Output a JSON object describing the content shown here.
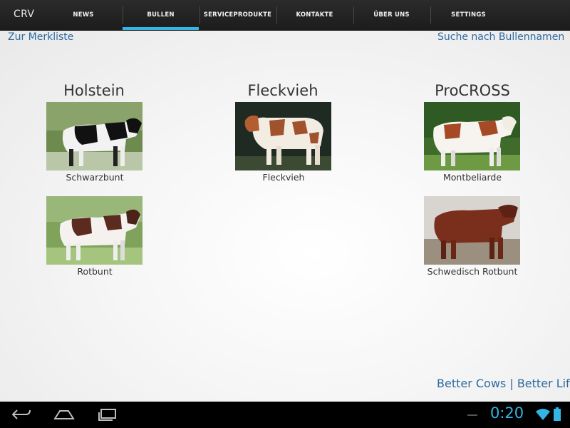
{
  "app": {
    "title": "CRV"
  },
  "tabs": [
    {
      "label": "News"
    },
    {
      "label": "Bullen"
    },
    {
      "label": "Serviceprodukte"
    },
    {
      "label": "Kontakte"
    },
    {
      "label": "Über uns"
    },
    {
      "label": "Settings"
    }
  ],
  "active_tab": "Bullen",
  "links": {
    "merkliste": "Zur Merkliste",
    "suche": "Suche nach Bullennamen"
  },
  "breeds": [
    {
      "title": "Holstein",
      "items": [
        "Schwarzbunt",
        "Rotbunt"
      ]
    },
    {
      "title": "Fleckvieh",
      "items": [
        "Fleckvieh"
      ]
    },
    {
      "title": "ProCROSS",
      "items": [
        "Montbeliarde",
        "Schwedisch Rotbunt"
      ]
    }
  ],
  "slogan": "Better Cows | Better Life",
  "status": {
    "time": "0:20"
  },
  "colors": {
    "accent": "#33b5e5",
    "link": "#2c6aa0"
  }
}
